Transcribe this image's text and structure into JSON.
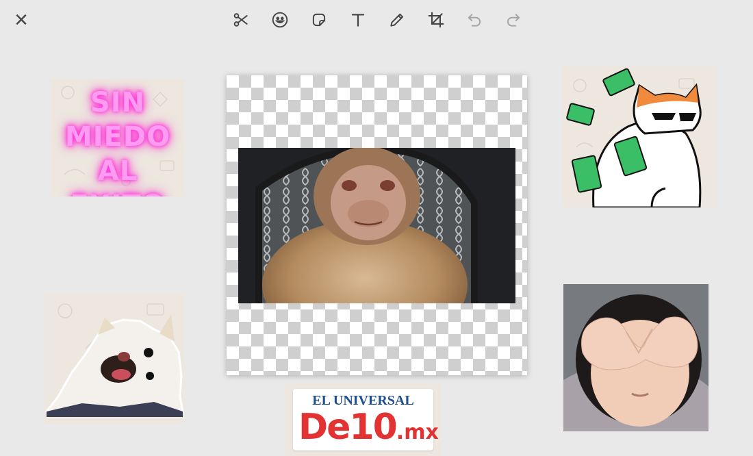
{
  "toolbar": {
    "close": "×",
    "tools": [
      {
        "id": "cut",
        "icon": "scissors-icon"
      },
      {
        "id": "emoji",
        "icon": "emoji-icon"
      },
      {
        "id": "sticker",
        "icon": "sticker-icon"
      },
      {
        "id": "text",
        "icon": "text-icon"
      },
      {
        "id": "draw",
        "icon": "pencil-icon"
      },
      {
        "id": "crop",
        "icon": "crop-icon"
      },
      {
        "id": "undo",
        "icon": "undo-icon"
      },
      {
        "id": "redo",
        "icon": "redo-icon"
      }
    ]
  },
  "stickers": {
    "neon": {
      "text": "SIN\nMIEDO AL\nEXITO"
    },
    "logo": {
      "top": "EL UNIVERSAL",
      "main": "De10",
      "suffix": ".mx"
    }
  },
  "colors": {
    "background": "#e9e9e9",
    "neon_pink": "#ff9cf2",
    "logo_blue": "#1f4f8f",
    "logo_red": "#e23232"
  }
}
